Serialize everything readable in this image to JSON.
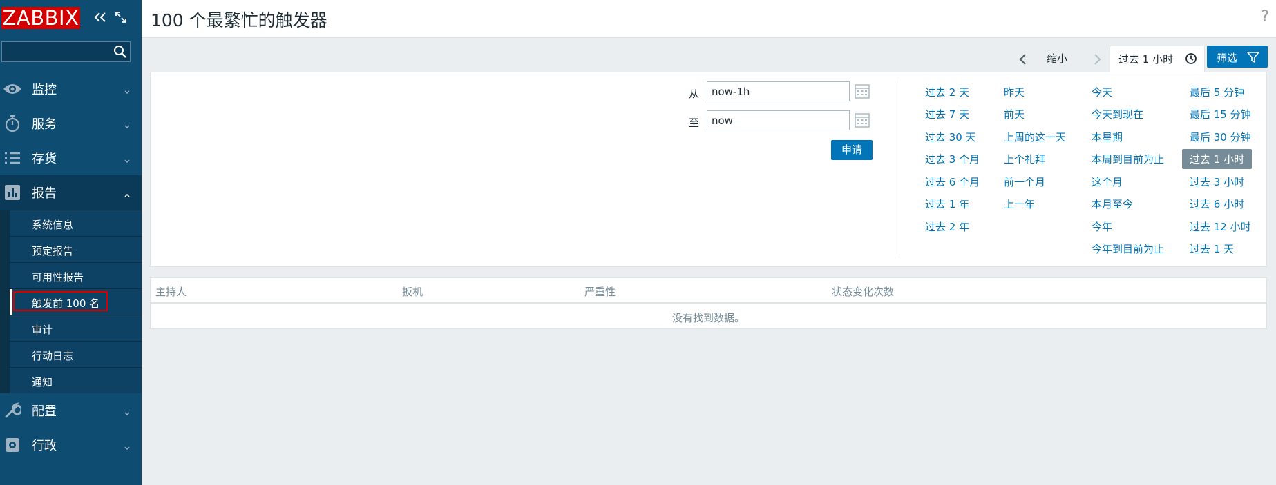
{
  "brand": {
    "logo_text": "ZABBIX",
    "color": "#d40000"
  },
  "sidebar": {
    "search": {
      "value": "",
      "placeholder": ""
    },
    "menu": [
      {
        "label": "监控",
        "icon": "eye-icon"
      },
      {
        "label": "服务",
        "icon": "stopwatch-icon"
      },
      {
        "label": "存货",
        "icon": "list-icon"
      },
      {
        "label": "报告",
        "icon": "bar-chart-icon",
        "expanded": true
      },
      {
        "label": "配置",
        "icon": "wrench-icon"
      },
      {
        "label": "行政",
        "icon": "gear-icon"
      }
    ],
    "report_submenu": [
      "系统信息",
      "预定报告",
      "可用性报告",
      "触发前 100 名",
      "审计",
      "行动日志",
      "通知"
    ]
  },
  "header": {
    "title": "100 个最繁忙的触发器",
    "help": "?"
  },
  "timenav": {
    "zoom_out": "缩小",
    "current_range": "过去 1 小时",
    "filter_label": "筛选"
  },
  "filter": {
    "from_label": "从",
    "from_value": "now-1h",
    "to_label": "至",
    "to_value": "now",
    "apply_label": "申请",
    "quick_ranges": [
      [
        "过去 2 天",
        "过去 7 天",
        "过去 30 天",
        "过去 3 个月",
        "过去 6 个月",
        "过去 1 年",
        "过去 2 年"
      ],
      [
        "昨天",
        "前天",
        "上周的这一天",
        "上个礼拜",
        "前一个月",
        "上一年"
      ],
      [
        "今天",
        "今天到现在",
        "本星期",
        "本周到目前为止",
        "这个月",
        "本月至今",
        "今年",
        "今年到目前为止"
      ],
      [
        "最后 5 分钟",
        "最后 15 分钟",
        "最后 30 分钟",
        "过去 1 小时",
        "过去 3 小时",
        "过去 6 小时",
        "过去 12 小时",
        "过去 1 天"
      ]
    ],
    "selected_range": "过去 1 小时"
  },
  "table": {
    "columns": [
      "主持人",
      "扳机",
      "严重性",
      "状态变化次数"
    ],
    "empty_message": "没有找到数据。"
  },
  "colors": {
    "sidebar_bg": "#0e4c72",
    "link": "#0275b8",
    "button": "#0275b8"
  }
}
